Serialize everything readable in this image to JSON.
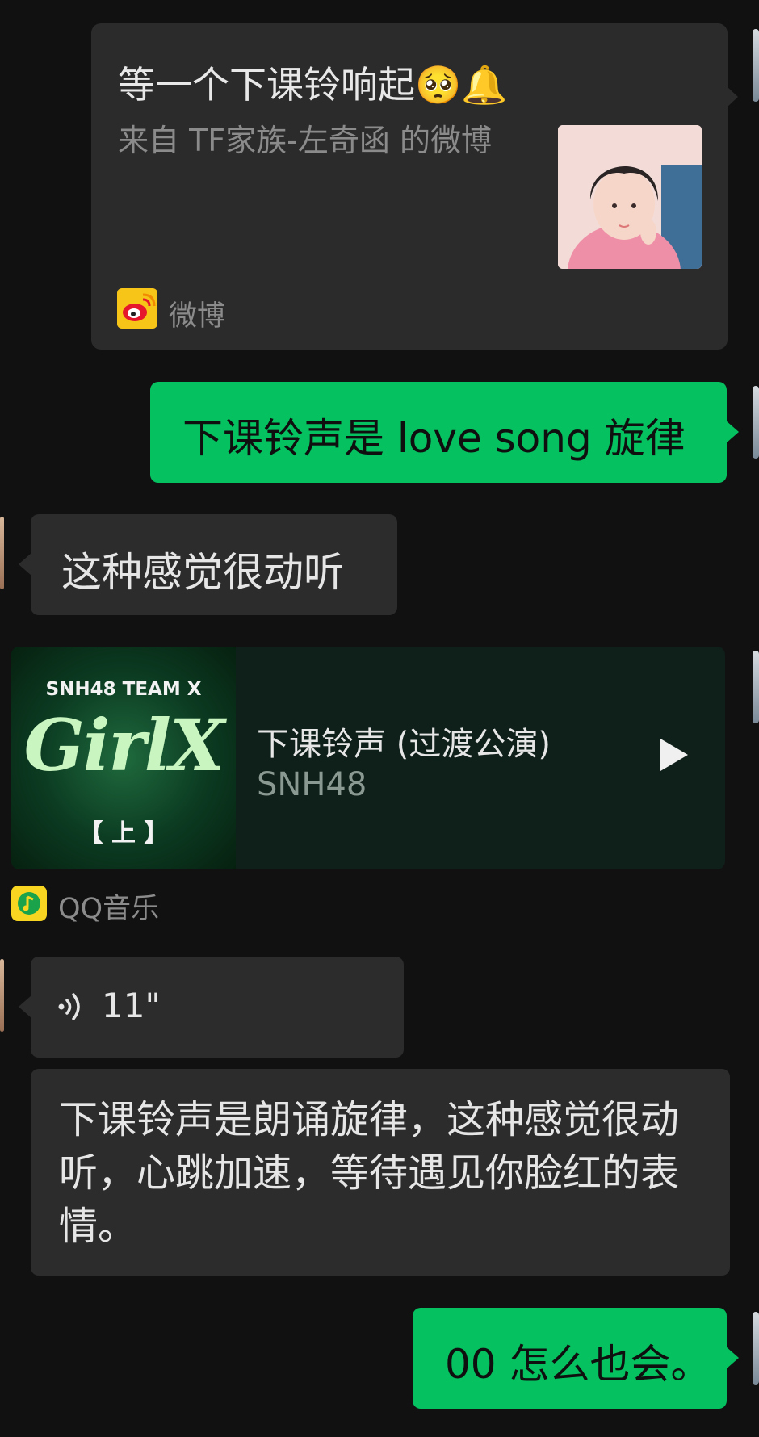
{
  "colors": {
    "background": "#111111",
    "sent_bubble": "#06c160",
    "received_bubble": "#2c2c2c",
    "card_background": "#2b2b2b",
    "music_card_background": "#0f1f19"
  },
  "link_card": {
    "title": "等一个下课铃响起🥺🔔",
    "description": "来自 TF家族-左奇函 的微博",
    "source_label": "微博",
    "source_icon": "weibo-icon",
    "thumbnail": "portrait-thumbnail"
  },
  "messages": {
    "love_song": "下课铃声是 love song 旋律",
    "feel_nice": "这种感觉很动听",
    "voice_duration": "11\"",
    "transcript": "下课铃声是朗诵旋律，这种感觉很动听，心跳加速，等待遇见你脸红的表情。",
    "last": "00 怎么也会。"
  },
  "music_card": {
    "cover_team": "SNH48 TEAM X",
    "cover_title": "GirlX",
    "cover_part": "【 上 】",
    "title": "下课铃声 (过渡公演)",
    "artist": "SNH48",
    "play_icon": "play-icon",
    "source_label": "QQ音乐",
    "source_icon": "qq-music-icon"
  }
}
